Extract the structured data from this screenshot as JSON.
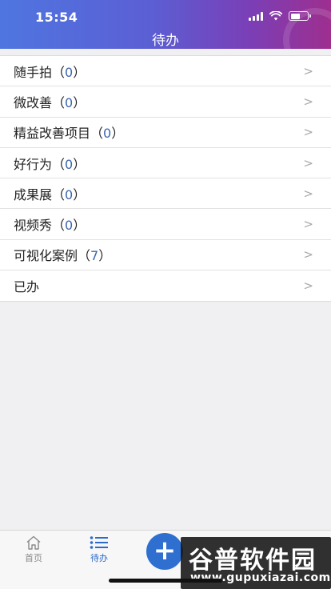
{
  "status": {
    "time": "15:54"
  },
  "header": {
    "title": "待办"
  },
  "list": [
    {
      "label": "随手拍",
      "count": "0"
    },
    {
      "label": "微改善",
      "count": "0"
    },
    {
      "label": "精益改善项目",
      "count": "0"
    },
    {
      "label": "好行为",
      "count": "0"
    },
    {
      "label": "成果展",
      "count": "0"
    },
    {
      "label": "视频秀",
      "count": "0"
    },
    {
      "label": "可视化案例",
      "count": "7"
    },
    {
      "label": "已办"
    }
  ],
  "tabs": [
    {
      "label": "首页",
      "icon": "home-icon"
    },
    {
      "label": "待办",
      "icon": "list-icon",
      "active": true
    }
  ],
  "fab": {
    "icon": "plus-icon"
  },
  "watermark": {
    "brand": "谷普软件园",
    "url": "www.gupuxiazai.com"
  },
  "colors": {
    "accent": "#2e6fd0",
    "count": "#3a66b0"
  }
}
